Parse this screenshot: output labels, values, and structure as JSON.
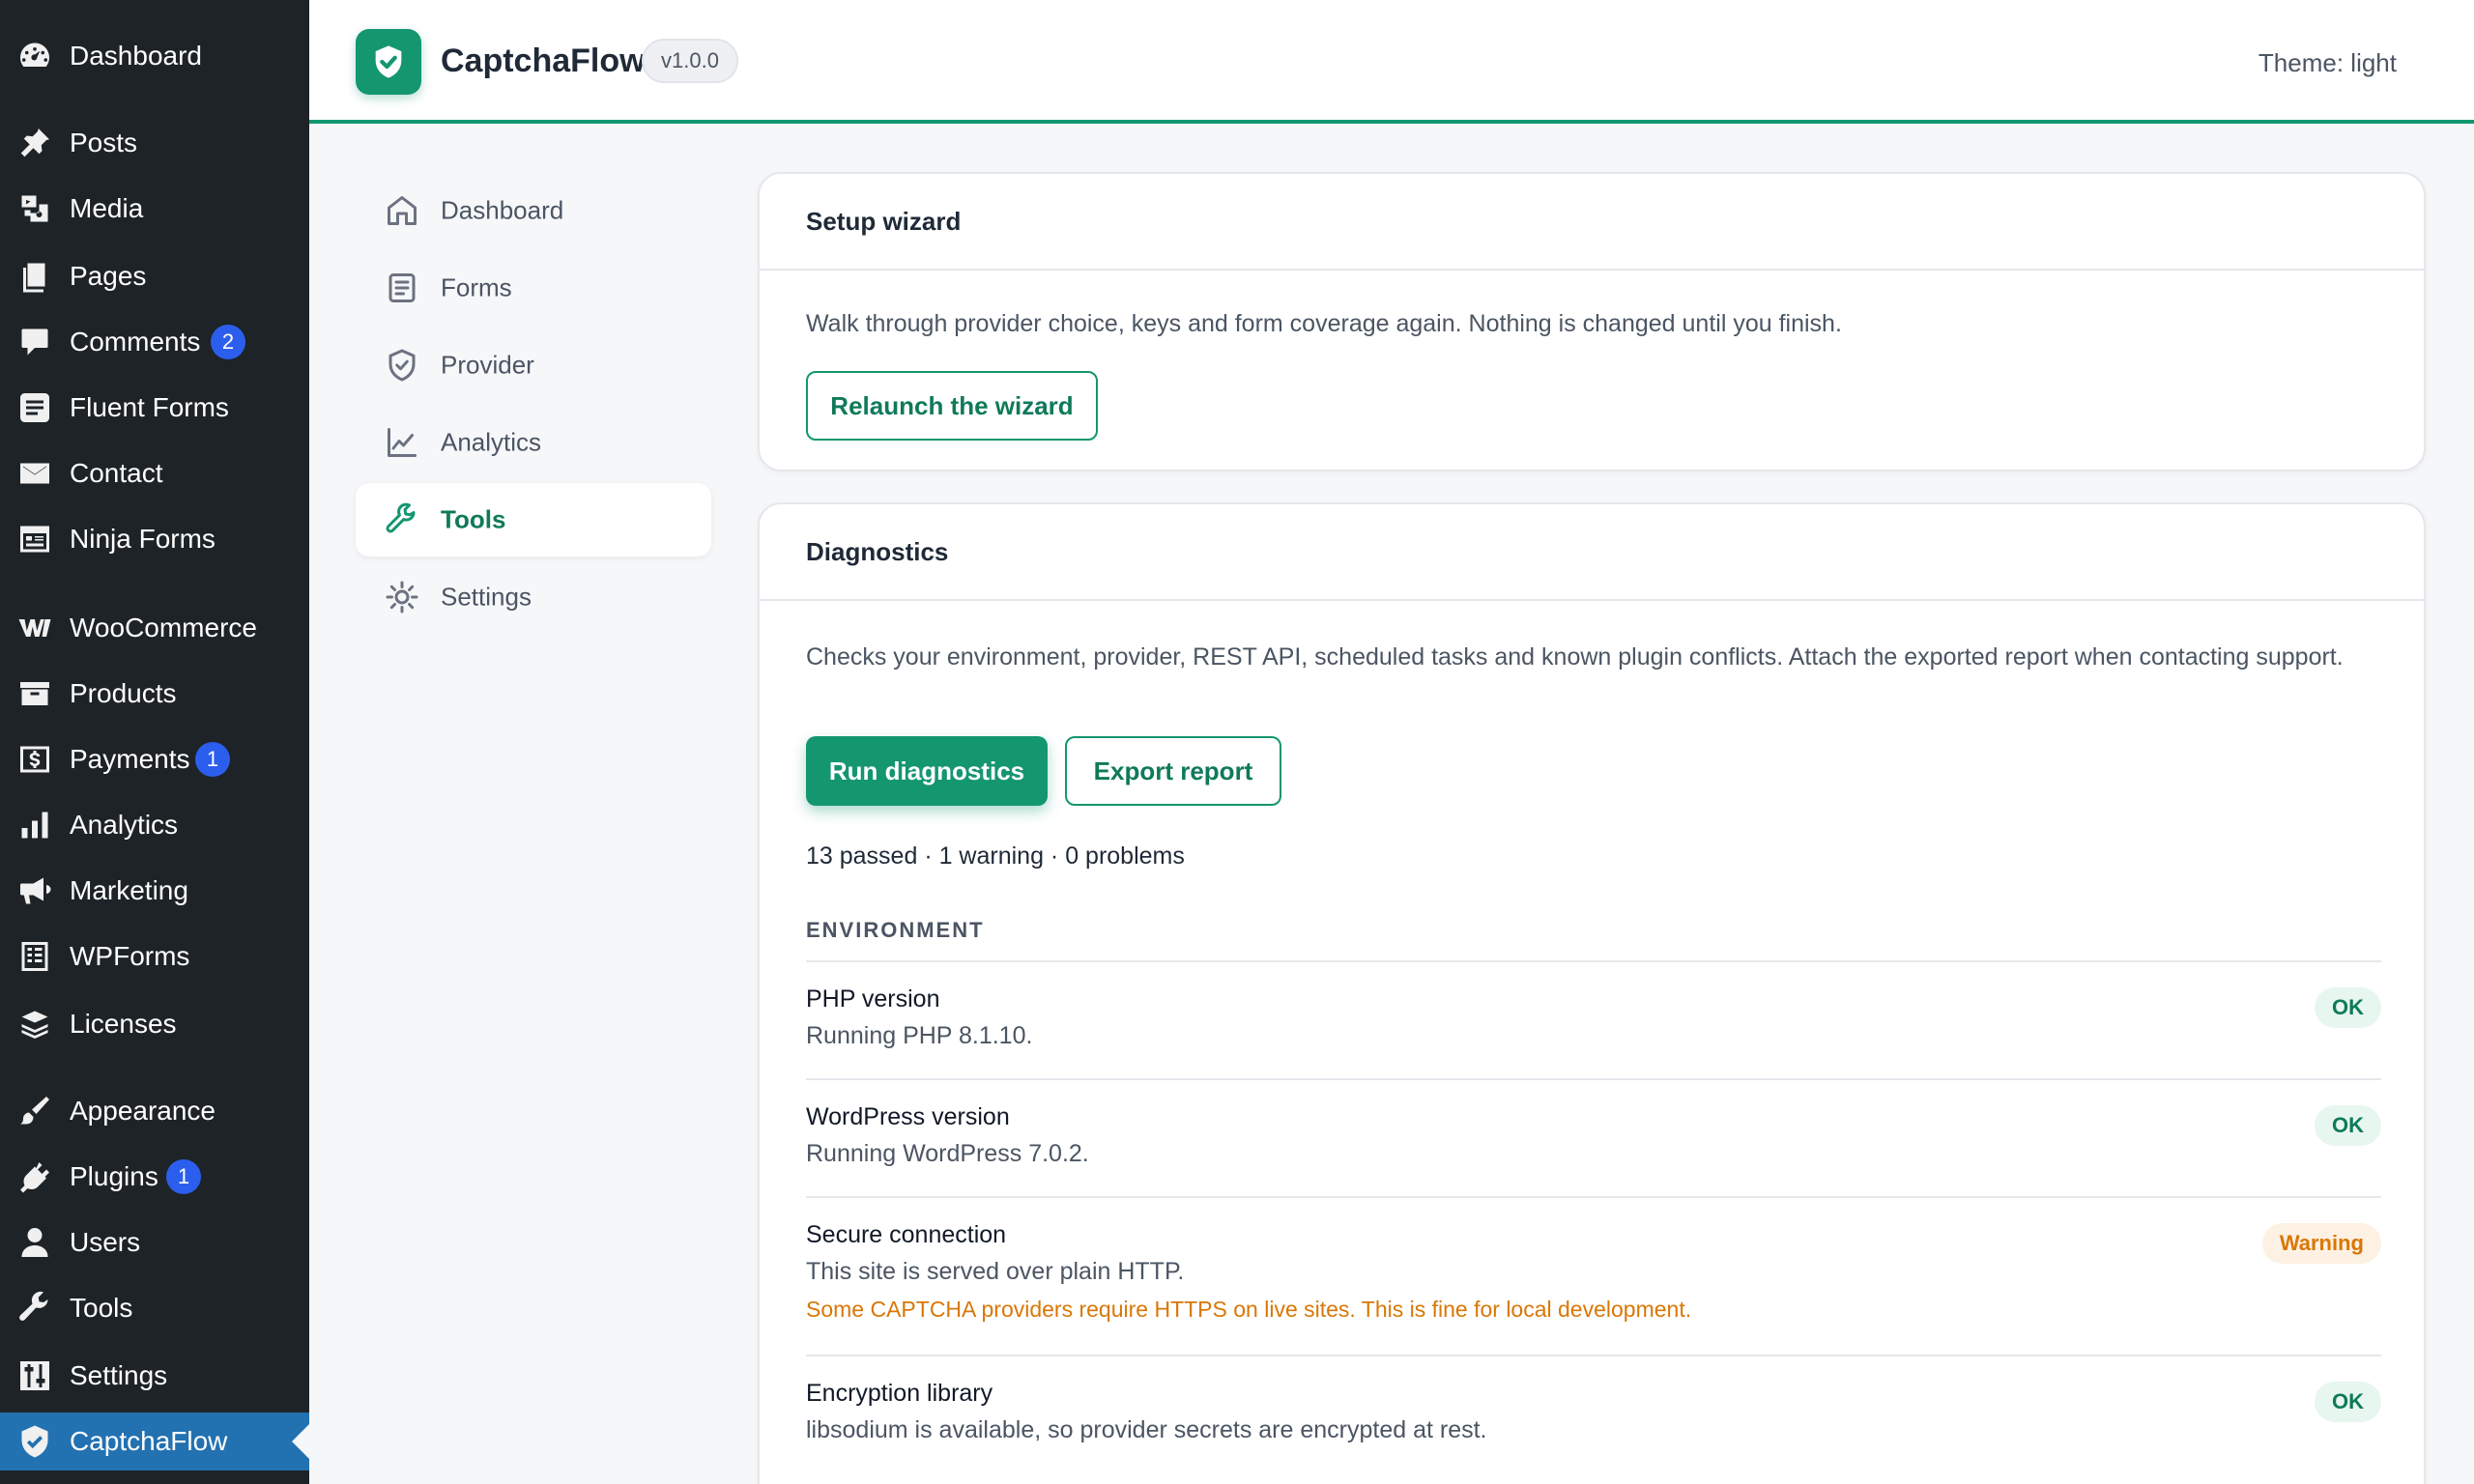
{
  "wp_menu": [
    {
      "label": "Dashboard",
      "icon": "dashboard-icon"
    },
    {
      "label": "Posts",
      "icon": "pin-icon"
    },
    {
      "label": "Media",
      "icon": "media-icon"
    },
    {
      "label": "Pages",
      "icon": "pages-icon"
    },
    {
      "label": "Comments",
      "icon": "comment-icon",
      "badge": "2"
    },
    {
      "label": "Fluent Forms",
      "icon": "form-icon"
    },
    {
      "label": "Contact",
      "icon": "mail-icon"
    },
    {
      "label": "Ninja Forms",
      "icon": "form-list-icon"
    },
    {
      "label": "WooCommerce",
      "icon": "woo-icon"
    },
    {
      "label": "Products",
      "icon": "archive-icon"
    },
    {
      "label": "Payments",
      "icon": "dollar-icon",
      "badge": "1"
    },
    {
      "label": "Analytics",
      "icon": "bar-chart-icon"
    },
    {
      "label": "Marketing",
      "icon": "megaphone-icon"
    },
    {
      "label": "WPForms",
      "icon": "wpforms-icon"
    },
    {
      "label": "Licenses",
      "icon": "stack-icon"
    },
    {
      "label": "Appearance",
      "icon": "brush-icon"
    },
    {
      "label": "Plugins",
      "icon": "plug-icon",
      "badge": "1"
    },
    {
      "label": "Users",
      "icon": "user-icon"
    },
    {
      "label": "Tools",
      "icon": "wrench-icon"
    },
    {
      "label": "Settings",
      "icon": "sliders-icon"
    },
    {
      "label": "CaptchaFlow",
      "icon": "shield-icon",
      "active": true
    }
  ],
  "header": {
    "title": "CaptchaFlow",
    "version": "v1.0.0",
    "theme": "Theme: light"
  },
  "nav": [
    {
      "label": "Dashboard",
      "icon": "home-icon"
    },
    {
      "label": "Forms",
      "icon": "document-icon"
    },
    {
      "label": "Provider",
      "icon": "shield-check-icon"
    },
    {
      "label": "Analytics",
      "icon": "line-chart-icon"
    },
    {
      "label": "Tools",
      "icon": "wrench-icon",
      "active": true
    },
    {
      "label": "Settings",
      "icon": "sun-gear-icon"
    }
  ],
  "setup_wizard": {
    "title": "Setup wizard",
    "description": "Walk through provider choice, keys and form coverage again. Nothing is changed until you finish.",
    "button": "Relaunch the wizard"
  },
  "diagnostics": {
    "title": "Diagnostics",
    "description": "Checks your environment, provider, REST API, scheduled tasks and known plugin conflicts. Attach the exported report when contacting support.",
    "run_button": "Run diagnostics",
    "export_button": "Export report",
    "summary": "13 passed · 1 warning · 0 problems",
    "section": "ENVIRONMENT",
    "checks": [
      {
        "title": "PHP version",
        "detail": "Running PHP 8.1.10.",
        "status": "OK",
        "level": "ok"
      },
      {
        "title": "WordPress version",
        "detail": "Running WordPress 7.0.2.",
        "status": "OK",
        "level": "ok"
      },
      {
        "title": "Secure connection",
        "detail": "This site is served over plain HTTP.",
        "note": "Some CAPTCHA providers require HTTPS on live sites. This is fine for local development.",
        "status": "Warning",
        "level": "warning"
      },
      {
        "title": "Encryption library",
        "detail": "libsodium is available, so provider secrets are encrypted at rest.",
        "status": "OK",
        "level": "ok"
      }
    ]
  },
  "colors": {
    "accent": "#14966f",
    "wp_sidebar": "#1d2327",
    "wp_active": "#2271b1",
    "badge": "#2c5eee",
    "warning": "#d97706"
  }
}
